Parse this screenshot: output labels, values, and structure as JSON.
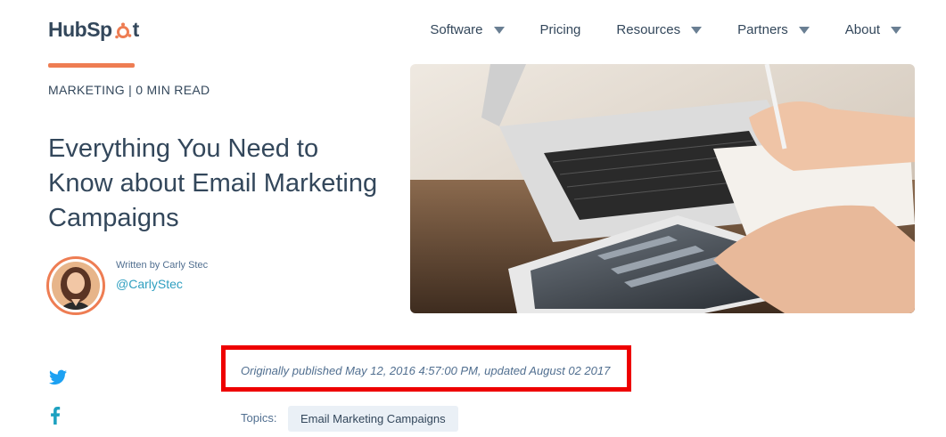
{
  "brand": {
    "logo_prefix": "HubSp",
    "logo_suffix": "t",
    "accent_color": "#ee7d53"
  },
  "nav": {
    "items": [
      {
        "label": "Software",
        "has_caret": true
      },
      {
        "label": "Pricing",
        "has_caret": false
      },
      {
        "label": "Resources",
        "has_caret": true
      },
      {
        "label": "Partners",
        "has_caret": true
      },
      {
        "label": "About",
        "has_caret": true
      }
    ]
  },
  "article": {
    "category": "MARKETING",
    "separator": " | ",
    "read_time": "0 MIN READ",
    "title": "Everything You Need to Know about Email Marketing Campaigns",
    "author_line": "Written by Carly Stec",
    "author_handle": "@CarlyStec",
    "published": "Originally published May 12, 2016 4:57:00 PM, updated August 02 2017",
    "topics_label": "Topics:",
    "topics": [
      "Email Marketing Campaigns"
    ]
  },
  "social": [
    "twitter-icon",
    "facebook-icon"
  ],
  "highlight_color": "#ee0000"
}
